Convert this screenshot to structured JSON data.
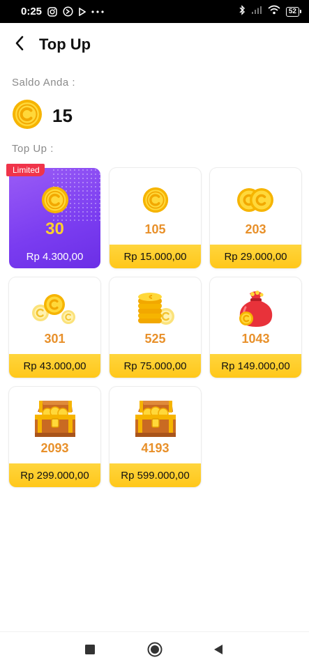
{
  "status_bar": {
    "time": "0:25",
    "battery": "52"
  },
  "header": {
    "title": "Top Up",
    "back_icon": "chevron-left-icon"
  },
  "balance": {
    "label": "Saldo Anda :",
    "value": "15",
    "icon": "coin-icon"
  },
  "topup": {
    "label": "Top Up :",
    "limited_badge": "Limited",
    "packages": [
      {
        "amount": "30",
        "price": "Rp 4.300,00",
        "icon": "single-coin-icon"
      },
      {
        "amount": "105",
        "price": "Rp 15.000,00",
        "icon": "single-coin-icon"
      },
      {
        "amount": "203",
        "price": "Rp 29.000,00",
        "icon": "double-coin-icon"
      },
      {
        "amount": "301",
        "price": "Rp 43.000,00",
        "icon": "scattered-coins-icon"
      },
      {
        "amount": "525",
        "price": "Rp 75.000,00",
        "icon": "coin-stack-icon"
      },
      {
        "amount": "1043",
        "price": "Rp 149.000,00",
        "icon": "coin-bag-icon"
      },
      {
        "amount": "2093",
        "price": "Rp 299.000,00",
        "icon": "treasure-chest-icon"
      },
      {
        "amount": "4193",
        "price": "Rp 599.000,00",
        "icon": "treasure-chest-icon"
      }
    ]
  },
  "nav": {
    "icons": [
      "square-icon",
      "circle-icon",
      "triangle-back-icon"
    ]
  },
  "colors": {
    "accent_yellow": "#ffc71a",
    "amount_orange": "#e8902a",
    "limited_purple": "#7a3cf0",
    "limited_badge_red": "#f0344a"
  }
}
